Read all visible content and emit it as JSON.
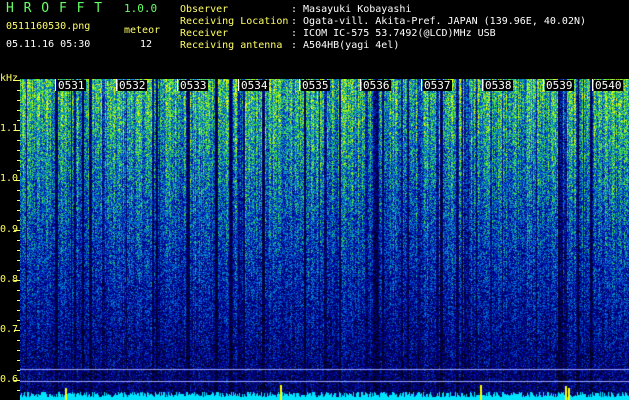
{
  "header": {
    "app_name": "H R O F F T",
    "version": "1.0.0",
    "filename": "0511160530.png",
    "meteor_label": "meteor",
    "datetime": "05.11.16 05:30",
    "meteor_count": "12",
    "observer_label": "Observer",
    "observer_value": ": Masayuki Kobayashi",
    "location_label": "Receiving Location",
    "location_value": ": Ogata-vill. Akita-Pref. JAPAN (139.96E, 40.02N)",
    "receiver_label": "Receiver",
    "receiver_value": ": ICOM IC-575 53.7492(@LCD)MHz USB",
    "antenna_label": "Receiving antenna",
    "antenna_value": ": A504HB(yagi 4el)"
  },
  "axis": {
    "unit": "kHz",
    "y_labels": [
      "1.1",
      "1.0",
      "0.9",
      "0.8",
      "0.7",
      "0.6"
    ],
    "time_labels": [
      "0531",
      "0532",
      "0533",
      "0534",
      "0535",
      "0536",
      "0537",
      "0538",
      "0539",
      "0540"
    ]
  },
  "colors": {
    "green_text": "#66ff66",
    "yellow_text": "#ffff66",
    "white_text": "#ffffff",
    "background": "#000000",
    "spectrum_low": "#000033",
    "spectrum_high": "#ffff00",
    "baseline": "#00e5ff"
  }
}
